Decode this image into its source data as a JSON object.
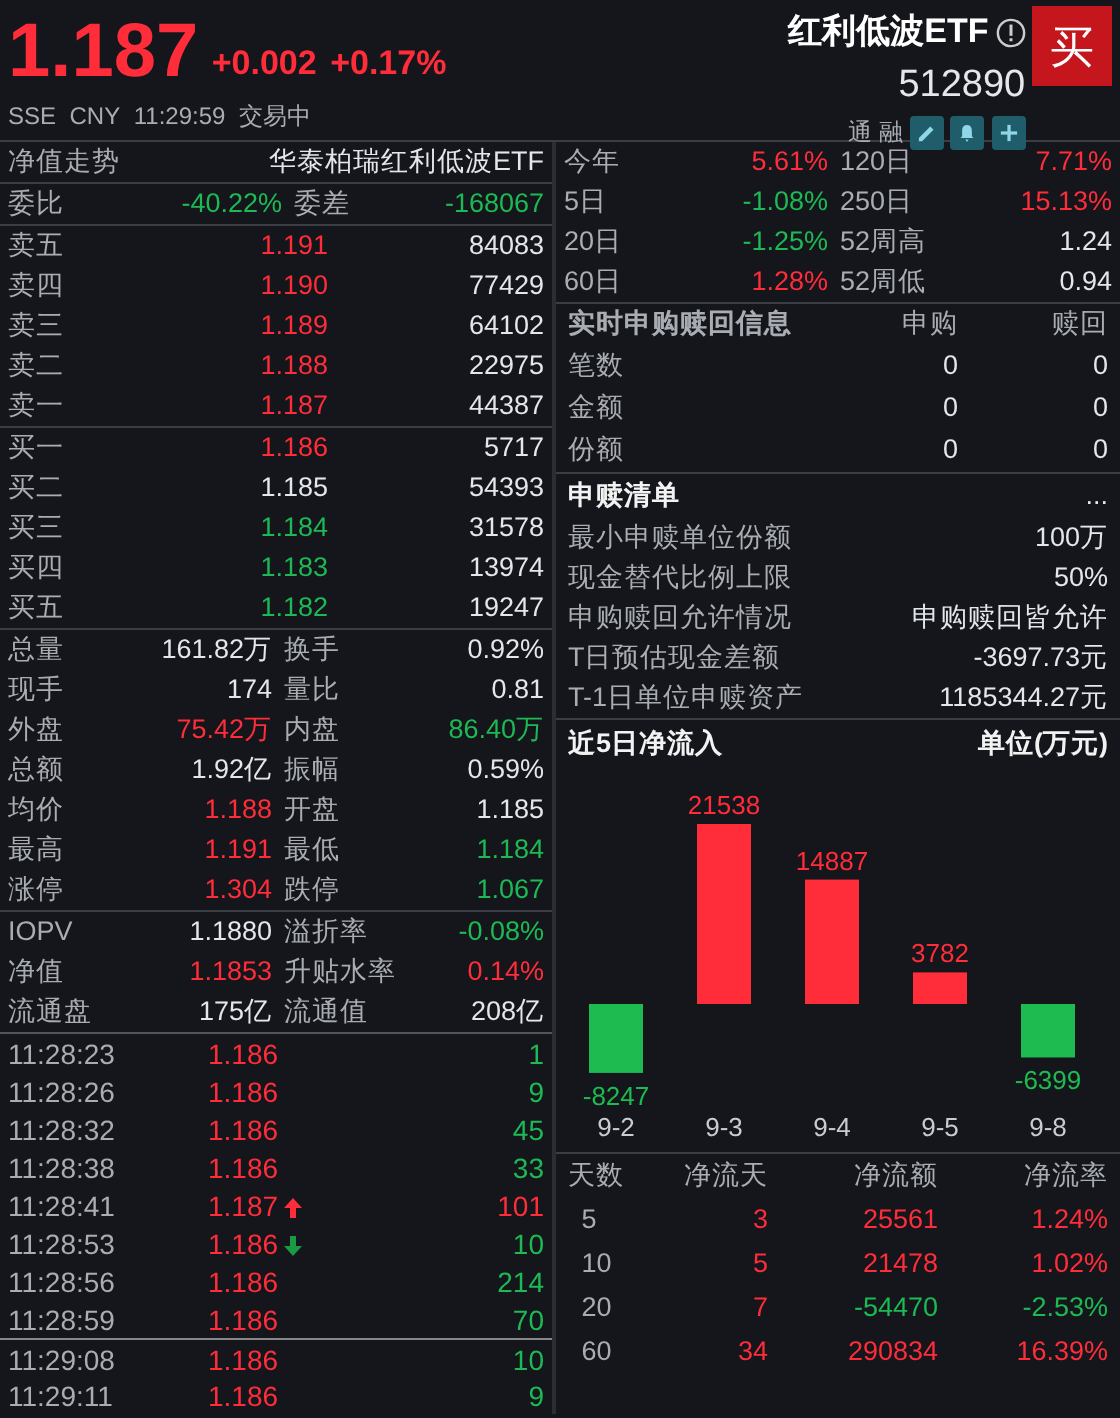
{
  "quote": {
    "price": "1.187",
    "change": "+0.002",
    "change_pct": "+0.17%",
    "color": "#ff2d3a",
    "name": "红利低波ETF",
    "code": "512890",
    "buy_button": "买",
    "exchange": "SSE",
    "currency": "CNY",
    "time": "11:29:59",
    "status": "交易中",
    "tags": [
      "通",
      "融"
    ]
  },
  "left_header": {
    "title": "净值走势",
    "fund_name": "华泰柏瑞红利低波ETF"
  },
  "order_ratio": [
    {
      "text": "委比"
    },
    {
      "text": "-40.22%",
      "color": "#1db954"
    },
    {
      "text": "委差"
    },
    {
      "text": "-168067",
      "color": "#1db954"
    }
  ],
  "asks": [
    {
      "label": "卖五",
      "price": "1.191",
      "color": "#ff2d3a",
      "volume": "84083"
    },
    {
      "label": "卖四",
      "price": "1.190",
      "color": "#ff2d3a",
      "volume": "77429"
    },
    {
      "label": "卖三",
      "price": "1.189",
      "color": "#ff2d3a",
      "volume": "64102"
    },
    {
      "label": "卖二",
      "price": "1.188",
      "color": "#ff2d3a",
      "volume": "22975"
    },
    {
      "label": "卖一",
      "price": "1.187",
      "color": "#ff2d3a",
      "volume": "44387"
    }
  ],
  "bids": [
    {
      "label": "买一",
      "price": "1.186",
      "color": "#ff2d3a",
      "volume": "5717"
    },
    {
      "label": "买二",
      "price": "1.185",
      "color": "#e3e6ea",
      "volume": "54393"
    },
    {
      "label": "买三",
      "price": "1.184",
      "color": "#1db954",
      "volume": "31578"
    },
    {
      "label": "买四",
      "price": "1.183",
      "color": "#1db954",
      "volume": "13974"
    },
    {
      "label": "买五",
      "price": "1.182",
      "color": "#1db954",
      "volume": "19247"
    }
  ],
  "stats": [
    [
      {
        "text": "总量"
      },
      {
        "text": "161.82万",
        "color": "#e3e6ea"
      },
      {
        "text": "换手"
      },
      {
        "text": "0.92%",
        "color": "#e3e6ea"
      }
    ],
    [
      {
        "text": "现手"
      },
      {
        "text": "174",
        "color": "#e3e6ea"
      },
      {
        "text": "量比"
      },
      {
        "text": "0.81",
        "color": "#e3e6ea"
      }
    ],
    [
      {
        "text": "外盘"
      },
      {
        "text": "75.42万",
        "color": "#ff2d3a"
      },
      {
        "text": "内盘"
      },
      {
        "text": "86.40万",
        "color": "#1db954"
      }
    ],
    [
      {
        "text": "总额"
      },
      {
        "text": "1.92亿",
        "color": "#e3e6ea"
      },
      {
        "text": "振幅"
      },
      {
        "text": "0.59%",
        "color": "#e3e6ea"
      }
    ],
    [
      {
        "text": "均价"
      },
      {
        "text": "1.188",
        "color": "#ff2d3a"
      },
      {
        "text": "开盘"
      },
      {
        "text": "1.185",
        "color": "#e3e6ea"
      }
    ],
    [
      {
        "text": "最高"
      },
      {
        "text": "1.191",
        "color": "#ff2d3a"
      },
      {
        "text": "最低"
      },
      {
        "text": "1.184",
        "color": "#1db954"
      }
    ],
    [
      {
        "text": "涨停"
      },
      {
        "text": "1.304",
        "color": "#ff2d3a"
      },
      {
        "text": "跌停"
      },
      {
        "text": "1.067",
        "color": "#1db954"
      }
    ]
  ],
  "etf_stats": [
    [
      {
        "text": "IOPV"
      },
      {
        "text": "1.1880",
        "color": "#e3e6ea"
      },
      {
        "text": "溢折率"
      },
      {
        "text": "-0.08%",
        "color": "#1db954"
      }
    ],
    [
      {
        "text": "净值"
      },
      {
        "text": "1.1853",
        "color": "#ff2d3a"
      },
      {
        "text": "升贴水率"
      },
      {
        "text": "0.14%",
        "color": "#ff2d3a"
      }
    ],
    [
      {
        "text": "流通盘"
      },
      {
        "text": "175亿",
        "color": "#e3e6ea"
      },
      {
        "text": "流通值"
      },
      {
        "text": "208亿",
        "color": "#e3e6ea"
      }
    ]
  ],
  "trades": [
    {
      "time": "11:28:23",
      "price": "1.186",
      "kind": "plain",
      "volume": "1",
      "color": "#1db954"
    },
    {
      "time": "11:28:26",
      "price": "1.186",
      "kind": "plain",
      "volume": "9",
      "color": "#1db954"
    },
    {
      "time": "11:28:32",
      "price": "1.186",
      "kind": "plain",
      "volume": "45",
      "color": "#1db954"
    },
    {
      "time": "11:28:38",
      "price": "1.186",
      "kind": "plain",
      "volume": "33",
      "color": "#1db954"
    },
    {
      "time": "11:28:41",
      "price": "1.187",
      "kind": "uptick",
      "volume": "101",
      "color": "#ff2d3a"
    },
    {
      "time": "11:28:53",
      "price": "1.186",
      "kind": "downtick",
      "volume": "10",
      "color": "#1db954"
    },
    {
      "time": "11:28:56",
      "price": "1.186",
      "kind": "plain",
      "volume": "214",
      "color": "#1db954"
    },
    {
      "time": "11:28:59",
      "price": "1.186",
      "kind": "plain",
      "volume": "70",
      "color": "#1db954"
    },
    {
      "time": "11:29:08",
      "price": "1.186",
      "kind": "plain",
      "volume": "10",
      "color": "#1db954",
      "divider_before": true
    },
    {
      "time": "11:29:11",
      "price": "1.186",
      "kind": "plain",
      "volume": "9",
      "color": "#1db954"
    }
  ],
  "returns": [
    [
      {
        "text": "今年"
      },
      {
        "text": "5.61%",
        "color": "#ff2d3a"
      },
      {
        "text": "120日"
      },
      {
        "text": "7.71%",
        "color": "#ff2d3a"
      }
    ],
    [
      {
        "text": "5日"
      },
      {
        "text": "-1.08%",
        "color": "#1db954"
      },
      {
        "text": "250日"
      },
      {
        "text": "15.13%",
        "color": "#ff2d3a"
      }
    ],
    [
      {
        "text": "20日"
      },
      {
        "text": "-1.25%",
        "color": "#1db954"
      },
      {
        "text": "52周高"
      },
      {
        "text": "1.24",
        "color": "#e3e6ea"
      }
    ],
    [
      {
        "text": "60日"
      },
      {
        "text": "1.28%",
        "color": "#ff2d3a"
      },
      {
        "text": "52周低"
      },
      {
        "text": "0.94",
        "color": "#e3e6ea"
      }
    ]
  ],
  "realtime_creation": {
    "title": "实时申购赎回信息",
    "columns": [
      "申购",
      "赎回"
    ],
    "rows": [
      {
        "label": "笔数",
        "values": [
          "0",
          "0"
        ]
      },
      {
        "label": "金额",
        "values": [
          "0",
          "0"
        ]
      },
      {
        "label": "份额",
        "values": [
          "0",
          "0"
        ]
      }
    ]
  },
  "creation_list": {
    "title": "申赎清单",
    "more": "...",
    "rows": [
      {
        "label": "最小申赎单位份额",
        "value": "100万"
      },
      {
        "label": "现金替代比例上限",
        "value": "50%"
      },
      {
        "label": "申购赎回允许情况",
        "value": "申购赎回皆允许"
      },
      {
        "label": "T日预估现金差额",
        "value": "-3697.73元"
      },
      {
        "label": "T-1日单位申赎资产",
        "value": "1185344.27元"
      }
    ]
  },
  "net_inflow": {
    "title": "近5日净流入",
    "unit": "单位(万元)",
    "chart_data": {
      "type": "bar",
      "categories": [
        "9-2",
        "9-3",
        "9-4",
        "9-5",
        "9-8"
      ],
      "values": [
        -8247,
        21538,
        14887,
        3782,
        -6399
      ],
      "data_labels": true
    }
  },
  "flow_table": {
    "columns": [
      "天数",
      "净流天",
      "净流额",
      "净流率"
    ],
    "rows": [
      [
        {
          "text": "5"
        },
        {
          "text": "3",
          "color": "#ff2d3a"
        },
        {
          "text": "25561",
          "color": "#ff2d3a"
        },
        {
          "text": "1.24%",
          "color": "#ff2d3a"
        }
      ],
      [
        {
          "text": "10"
        },
        {
          "text": "5",
          "color": "#ff2d3a"
        },
        {
          "text": "21478",
          "color": "#ff2d3a"
        },
        {
          "text": "1.02%",
          "color": "#ff2d3a"
        }
      ],
      [
        {
          "text": "20"
        },
        {
          "text": "7",
          "color": "#ff2d3a"
        },
        {
          "text": "-54470",
          "color": "#1db954"
        },
        {
          "text": "-2.53%",
          "color": "#1db954"
        }
      ],
      [
        {
          "text": "60"
        },
        {
          "text": "34",
          "color": "#ff2d3a"
        },
        {
          "text": "290834",
          "color": "#ff2d3a"
        },
        {
          "text": "16.39%",
          "color": "#ff2d3a"
        }
      ]
    ]
  }
}
